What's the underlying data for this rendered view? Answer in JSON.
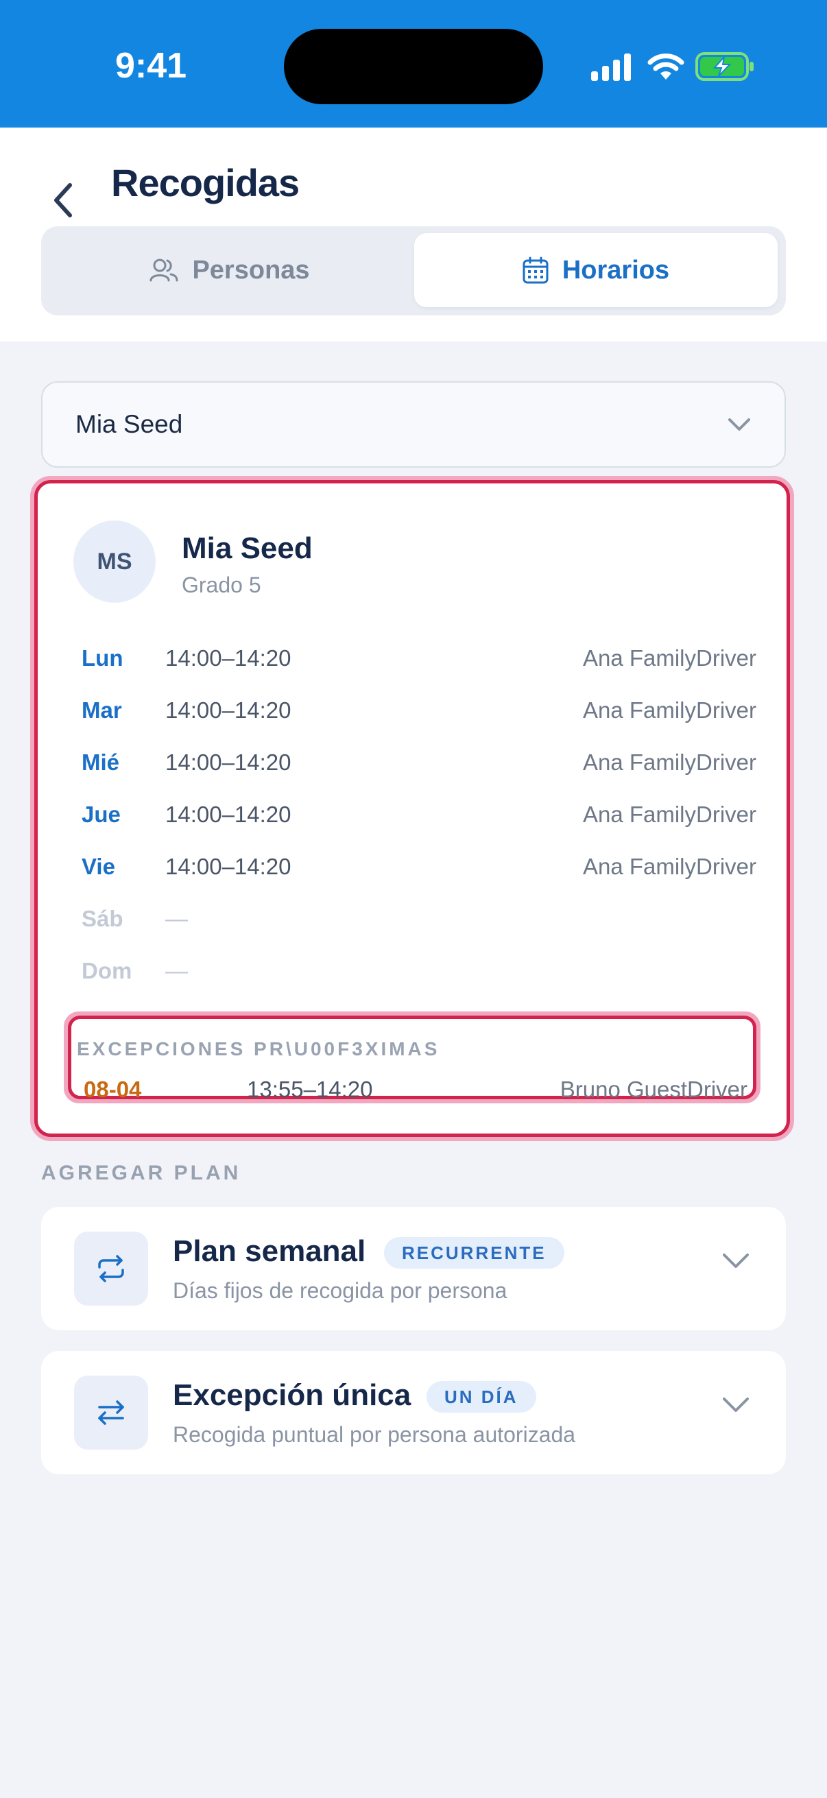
{
  "status_bar": {
    "time": "9:41"
  },
  "header": {
    "title": "Recogidas",
    "tabs": [
      {
        "label": "Personas",
        "icon": "people-icon",
        "active": false
      },
      {
        "label": "Horarios",
        "icon": "calendar-icon",
        "active": true
      }
    ]
  },
  "student_select": {
    "value": "Mia Seed"
  },
  "schedule": {
    "initials": "MS",
    "name": "Mia Seed",
    "grade": "Grado 5",
    "days": [
      {
        "day": "Lun",
        "time": "14:00–14:20",
        "driver": "Ana FamilyDriver"
      },
      {
        "day": "Mar",
        "time": "14:00–14:20",
        "driver": "Ana FamilyDriver"
      },
      {
        "day": "Mié",
        "time": "14:00–14:20",
        "driver": "Ana FamilyDriver"
      },
      {
        "day": "Jue",
        "time": "14:00–14:20",
        "driver": "Ana FamilyDriver"
      },
      {
        "day": "Vie",
        "time": "14:00–14:20",
        "driver": "Ana FamilyDriver"
      },
      {
        "day": "Sáb",
        "time": "—",
        "driver": ""
      },
      {
        "day": "Dom",
        "time": "—",
        "driver": ""
      }
    ],
    "exceptions_title": "EXCEPCIONES PR\\U00F3XIMAS",
    "exceptions": [
      {
        "date": "08-04",
        "time": "13:55–14:20",
        "driver": "Bruno GuestDriver"
      }
    ]
  },
  "add_plan": {
    "label": "AGREGAR PLAN",
    "plans": [
      {
        "title": "Plan semanal",
        "badge": "RECURRENTE",
        "subtitle": "Días fijos de recogida por persona",
        "icon": "repeat-icon"
      },
      {
        "title": "Excepción única",
        "badge": "UN DÍA",
        "subtitle": "Recogida puntual por persona autorizada",
        "icon": "swap-icon"
      }
    ]
  },
  "colors": {
    "status_bar": "#1286e0",
    "accent": "#1a6fc7",
    "highlight_border": "#d2234c",
    "exception_date": "#c96a12"
  }
}
